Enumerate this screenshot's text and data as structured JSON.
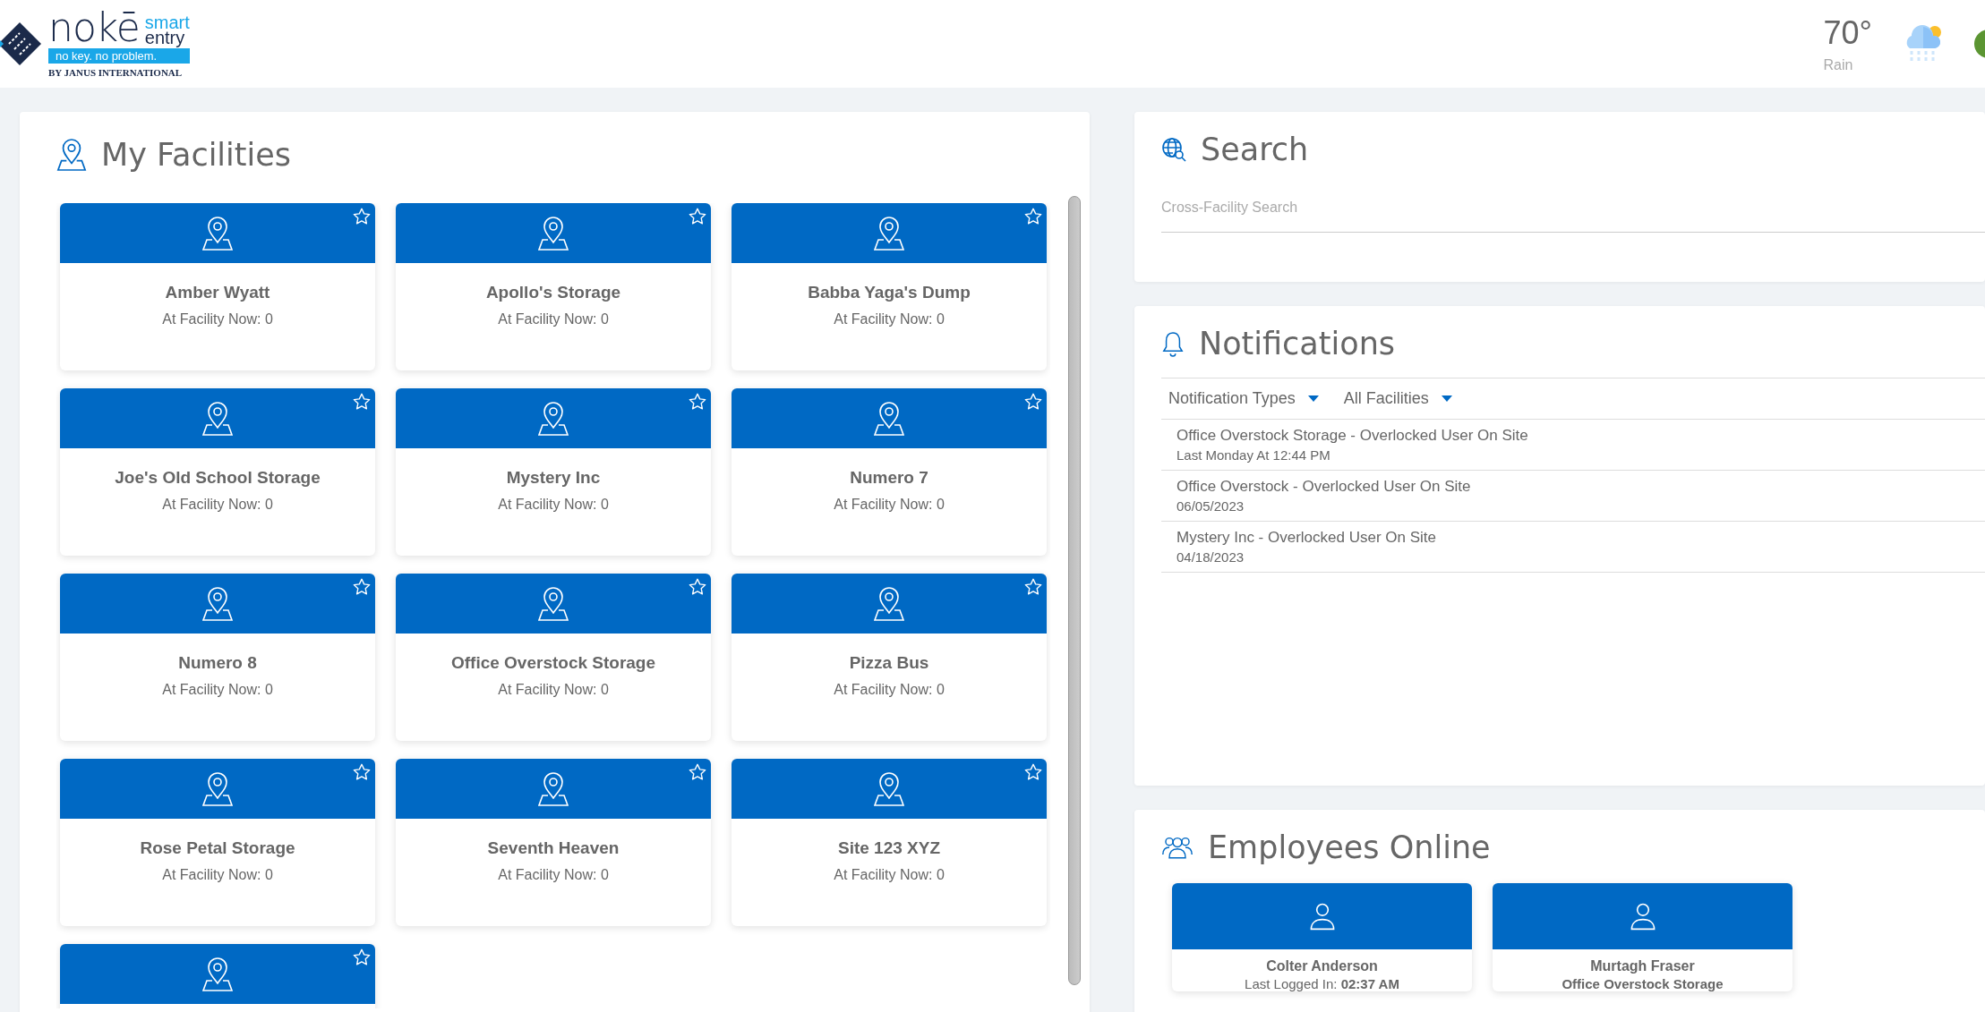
{
  "header": {
    "logo": {
      "brand": "nokē",
      "product_line_1": "smart",
      "product_line_2": "entry",
      "tagline": "no key. no problem.",
      "maker": "BY JANUS INTERNATIONAL"
    },
    "weather": {
      "temperature": "70°",
      "condition": "Rain"
    }
  },
  "facilities": {
    "title": "My Facilities",
    "items": [
      {
        "name": "Amber Wyatt",
        "count": "At Facility Now: 0",
        "favorite": false
      },
      {
        "name": "Apollo's Storage",
        "count": "At Facility Now: 0",
        "favorite": false
      },
      {
        "name": "Babba Yaga's Dump",
        "count": "At Facility Now: 0",
        "favorite": false
      },
      {
        "name": "Joe's Old School Storage",
        "count": "At Facility Now: 0",
        "favorite": false
      },
      {
        "name": "Mystery Inc",
        "count": "At Facility Now: 0",
        "favorite": false
      },
      {
        "name": "Numero 7",
        "count": "At Facility Now: 0",
        "favorite": false
      },
      {
        "name": "Numero 8",
        "count": "At Facility Now: 0",
        "favorite": false
      },
      {
        "name": "Office Overstock Storage",
        "count": "At Facility Now: 0",
        "favorite": false
      },
      {
        "name": "Pizza Bus",
        "count": "At Facility Now: 0",
        "favorite": false
      },
      {
        "name": "Rose Petal Storage",
        "count": "At Facility Now: 0",
        "favorite": false
      },
      {
        "name": "Seventh Heaven",
        "count": "At Facility Now: 0",
        "favorite": false
      },
      {
        "name": "Site 123 XYZ",
        "count": "At Facility Now: 0",
        "favorite": false
      },
      {
        "favorite": false
      }
    ]
  },
  "search": {
    "title": "Search",
    "placeholder": "Cross-Facility Search"
  },
  "notifications": {
    "title": "Notifications",
    "filters": [
      "Notification Types",
      "All Facilities"
    ],
    "items": [
      {
        "message": "Office Overstock Storage - Overlocked User On Site",
        "time": "Last Monday At 12:44 PM"
      },
      {
        "message": "Office Overstock - Overlocked User On Site",
        "time": "06/05/2023"
      },
      {
        "message": "Mystery Inc - Overlocked User On Site",
        "time": "04/18/2023"
      }
    ]
  },
  "employees": {
    "title": "Employees Online",
    "items": [
      {
        "name": "Colter Anderson",
        "detail": "Last Logged In: **02:37 AM**"
      },
      {
        "name": "Murtagh Fraser",
        "detail": "**Office Overstock Storage**"
      }
    ]
  }
}
